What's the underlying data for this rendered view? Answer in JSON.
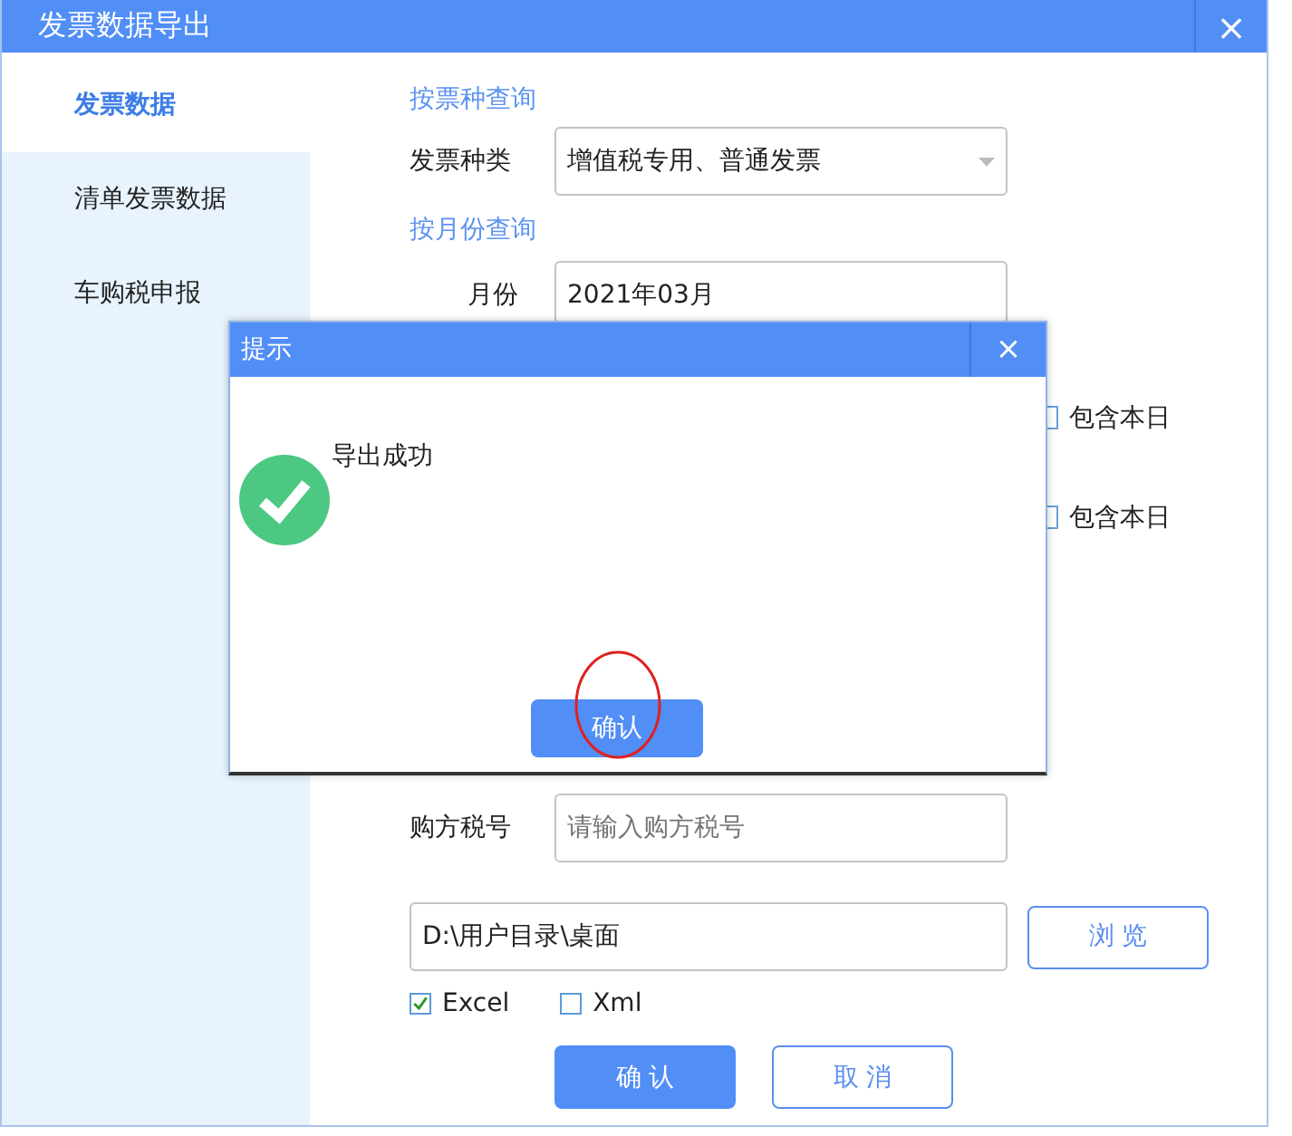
{
  "window": {
    "title": "发票数据导出",
    "close": "×"
  },
  "sidebar": {
    "items": [
      {
        "label": "发票数据",
        "selected": true
      },
      {
        "label": "清单发票数据",
        "selected": false
      },
      {
        "label": "车购税申报",
        "selected": false
      }
    ]
  },
  "form": {
    "section_type": "按票种查询",
    "invoice_type": {
      "label": "发票种类",
      "value": "增值税专用、普通发票"
    },
    "section_month": "按月份查询",
    "month": {
      "label": "月份",
      "value": "2021年03月"
    },
    "include_today": [
      "包含本日",
      "包含本日"
    ],
    "buyer_tax_id": {
      "label": "购方税号",
      "placeholder": "请输入购方税号"
    },
    "path": {
      "value": "D:\\用户目录\\桌面"
    },
    "browse": "浏 览",
    "formats": [
      {
        "label": "Excel",
        "checked": true
      },
      {
        "label": "Xml",
        "checked": false
      }
    ],
    "buttons": [
      {
        "label": "确 认",
        "kind": "primary"
      },
      {
        "label": "取 消",
        "kind": "secondary"
      }
    ]
  },
  "dialog": {
    "title": "提示",
    "close": "×",
    "message": "导出成功",
    "ok": "确认"
  }
}
